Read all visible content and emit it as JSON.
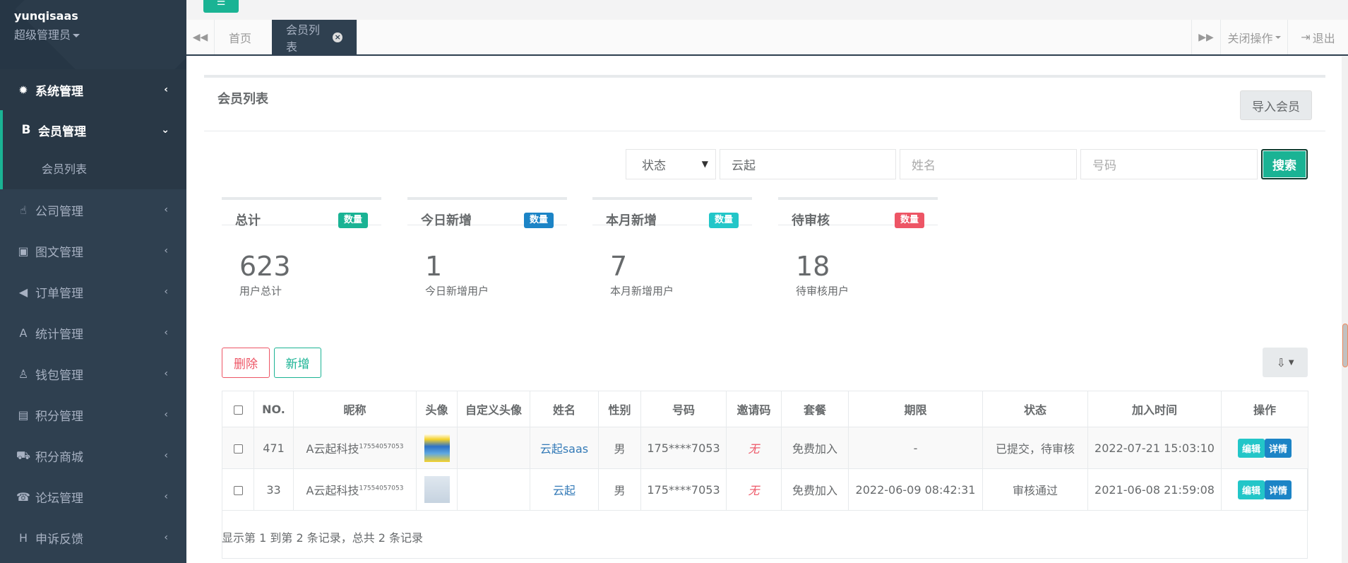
{
  "sidebar": {
    "user_name": "yunqisaas",
    "user_role": "超级管理员",
    "items": [
      {
        "label": "系统管理",
        "icon": "✹"
      },
      {
        "label": "会员管理",
        "icon": "B"
      },
      {
        "label": "公司管理",
        "icon": "☝"
      },
      {
        "label": "图文管理",
        "icon": "▣"
      },
      {
        "label": "订单管理",
        "icon": "◀"
      },
      {
        "label": "统计管理",
        "icon": "A"
      },
      {
        "label": "钱包管理",
        "icon": "♙"
      },
      {
        "label": "积分管理",
        "icon": "▤"
      },
      {
        "label": "积分商城",
        "icon": "⛟"
      },
      {
        "label": "论坛管理",
        "icon": "☎"
      },
      {
        "label": "申诉反馈",
        "icon": "H"
      }
    ],
    "sub_item": "会员列表"
  },
  "tabs": {
    "home": "首页",
    "active": "会员列表",
    "close_ops": "关闭操作",
    "logout": "退出"
  },
  "page": {
    "title": "会员列表",
    "import_label": "导入会员"
  },
  "search": {
    "status_select": "状态",
    "company_value": "云起",
    "name_placeholder": "姓名",
    "number_placeholder": "号码",
    "search_label": "搜索"
  },
  "stats": [
    {
      "name": "总计",
      "badge": "数量",
      "badge_color": "#1ab394",
      "value": "623",
      "desc": "用户总计"
    },
    {
      "name": "今日新增",
      "badge": "数量",
      "badge_color": "#1c84c6",
      "value": "1",
      "desc": "今日新增用户"
    },
    {
      "name": "本月新增",
      "badge": "数量",
      "badge_color": "#23c6c8",
      "value": "7",
      "desc": "本月新增用户"
    },
    {
      "name": "待审核",
      "badge": "数量",
      "badge_color": "#ed5565",
      "value": "18",
      "desc": "待审核用户"
    }
  ],
  "actions": {
    "delete": "删除",
    "add": "新增"
  },
  "table": {
    "headers": [
      "NO.",
      "昵称",
      "头像",
      "自定义头像",
      "姓名",
      "性别",
      "号码",
      "邀请码",
      "套餐",
      "期限",
      "状态",
      "加入时间",
      "操作"
    ],
    "rows": [
      {
        "no": "471",
        "nickname": "A云起科技",
        "nick_sup": "17554057053",
        "custom_avatar": "",
        "name": "云起saas",
        "gender": "男",
        "number": "175****7053",
        "invite": "无",
        "plan": "免费加入",
        "term": "-",
        "status": "已提交，待审核",
        "joined": "2022-07-21 15:03:10",
        "edit": "编辑",
        "detail": "详情"
      },
      {
        "no": "33",
        "nickname": "A云起科技",
        "nick_sup": "17554057053",
        "custom_avatar": "",
        "name": "云起",
        "gender": "男",
        "number": "175****7053",
        "invite": "无",
        "plan": "免费加入",
        "term": "2022-06-09 08:42:31",
        "status": "审核通过",
        "joined": "2021-06-08 21:59:08",
        "edit": "编辑",
        "detail": "详情"
      }
    ],
    "footer": "显示第 1 到第 2 条记录，总共 2 条记录"
  }
}
